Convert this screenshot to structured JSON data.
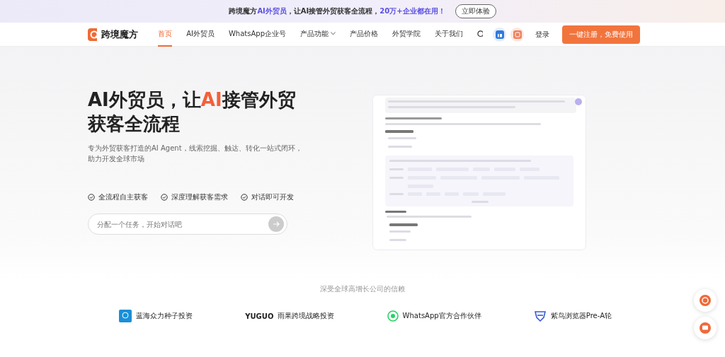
{
  "banner": {
    "segments": [
      {
        "text": "跨境魔方",
        "highlight": false
      },
      {
        "text": "AI外贸员",
        "highlight": true
      },
      {
        "text": "，让AI接管外贸获客全流程，",
        "highlight": false
      },
      {
        "text": "20万+企业都在用！",
        "highlight": true
      }
    ],
    "button": "立即体验"
  },
  "nav": {
    "brand": "跨境魔方",
    "items": [
      {
        "label": "首页",
        "selected": true,
        "kind": "link"
      },
      {
        "label": "AI外贸员",
        "selected": false,
        "kind": "link"
      },
      {
        "label": "WhatsApp企业号",
        "selected": false,
        "kind": "link"
      },
      {
        "label": "产品功能",
        "selected": false,
        "kind": "dropdown"
      },
      {
        "label": "产品价格",
        "selected": false,
        "kind": "link"
      },
      {
        "label": "外贸学院",
        "selected": false,
        "kind": "link"
      },
      {
        "label": "关于我们",
        "selected": false,
        "kind": "link"
      }
    ],
    "login": "登录",
    "cta": "一键注册，免费使用"
  },
  "hero": {
    "title_segments": [
      {
        "text": "AI外贸员，让",
        "highlight": false
      },
      {
        "text": "AI",
        "highlight": true
      },
      {
        "text": "接管外贸获客全流程",
        "highlight": false
      }
    ],
    "subtitle": "专为外贸获客打造的AI Agent，线索挖掘、触达、转化一站式闭环，助力开发全球市场",
    "features": [
      "全流程自主获客",
      "深度理解获客需求",
      "对话即可开发"
    ],
    "input": {
      "placeholder": "分配一个任务，开始对话吧"
    }
  },
  "trust": {
    "title": "深受全球高增长公司的信赖",
    "partners": [
      {
        "name": "蓝海众力种子投资",
        "kind": "blue"
      },
      {
        "name": "雨果跨境战略投资",
        "kind": "yuguo",
        "logo_text": "YUGUO"
      },
      {
        "name": "WhatsApp官方合作伙伴",
        "kind": "whatsapp"
      },
      {
        "name": "紫鸟浏览器Pre-A轮",
        "kind": "shield"
      }
    ]
  }
}
